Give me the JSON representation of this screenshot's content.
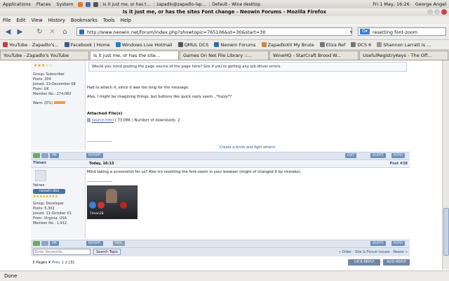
{
  "panel": {
    "menus": [
      "Applications",
      "Places",
      "System"
    ],
    "tasks": [
      "Is it just me, or has t...",
      "zapadlo@zapadlo-lap...",
      "Default - Wine desktop"
    ],
    "window_title": "Is it just me, or has the sites Font change - Neowin Forums - Mozilla Firefox",
    "clock": "Fri 1 May, 16:26",
    "user": "George Angel"
  },
  "menubar": [
    "File",
    "Edit",
    "View",
    "History",
    "Bookmarks",
    "Tools",
    "Help"
  ],
  "nav": {
    "url": "http://www.neowin.net/forum/index.php?showtopic=765106&st=30&start=30",
    "search_value": "resetting font-zoom"
  },
  "bookmarks": [
    {
      "label": "YouTube - Zapadlo's...",
      "color": "#d33"
    },
    {
      "label": "Facebook | Home",
      "color": "#3b5998"
    },
    {
      "label": "Windows Live Hotmail",
      "color": "#2a7ad1"
    },
    {
      "label": "QMUL DCS",
      "color": "#555"
    },
    {
      "label": "Neowin Forums",
      "color": "#2d6da8"
    },
    {
      "label": "ZapadloXII My Brute",
      "color": "#c84"
    },
    {
      "label": "Eliza Ref",
      "color": "#777"
    },
    {
      "label": "DCS 6",
      "color": "#777"
    },
    {
      "label": "Shannon Larratt is ...",
      "color": "#999"
    }
  ],
  "tabs": [
    {
      "label": "YouTube - Zapadlo's YouTube",
      "active": false
    },
    {
      "label": "Is it just me, or has the site...",
      "active": true
    },
    {
      "label": "Games On Net File Library ::...",
      "active": false
    },
    {
      "label": "WineHQ - StarCraft Brood W...",
      "active": false
    },
    {
      "label": "UsefulRegistryKeys - The Off...",
      "active": false
    }
  ],
  "post1": {
    "group": "Group: Subscriber",
    "posts": "Posts: 304",
    "joined": "Joined: 13-December 08",
    "from": "From: UK",
    "member": "Member No.: 274,082",
    "warn": "Warn: (0%)",
    "quote_text": "Would you mind posting the page source of the page here? See if you're getting any job driver errors.",
    "line1": "Had to attach it, since it was too long for the message.",
    "line2": "Also, I might be imagining things, but buttons like quick reply seem...*fuzzy*?",
    "attached_heading": "Attached File(s)",
    "attached_link": "source.html",
    "attached_meta": "( 73.08K ) Number of downloads: 2",
    "separator": "--------------------",
    "signature": "Create a brute and fight others!"
  },
  "post2": {
    "author": "Timan",
    "date": "Today, 16:13",
    "post_no": "Post #38",
    "username": "Yakree",
    "rank": "neowin dev",
    "group": "Group: Developer",
    "posts": "Posts: 5,302",
    "joined": "Joined: 11-October 01",
    "from": "From: Virginia, USA",
    "member": "Member No.: 1,912",
    "text": "Mind taking a screenshot for us? Also try resetting the font-zoom in your browser (might of changed it by mistake).",
    "separator": "--------------------",
    "card_name": "Timan28"
  },
  "buttons": {
    "pm": "PM",
    "report": "REPORT",
    "mail": "MAIL",
    "edit": "EDIT",
    "quote": "QUOTE",
    "reply": "REPLY",
    "search_placeholder": "Enter Keywords",
    "search_topic": "Search Topic",
    "fast_reply": "UICK REPLY",
    "add_reply": "ADD REPLY"
  },
  "footer": {
    "breadcrumb": "« Older · Site & Forum Issues · Newer »",
    "pages": "3 Pages ▾",
    "prev": "Prev",
    "page_links": "1 2",
    "current_page": "[3]"
  },
  "status": "Done",
  "colors": {
    "accent": "#6e8fba",
    "link": "#2d4f8a"
  }
}
